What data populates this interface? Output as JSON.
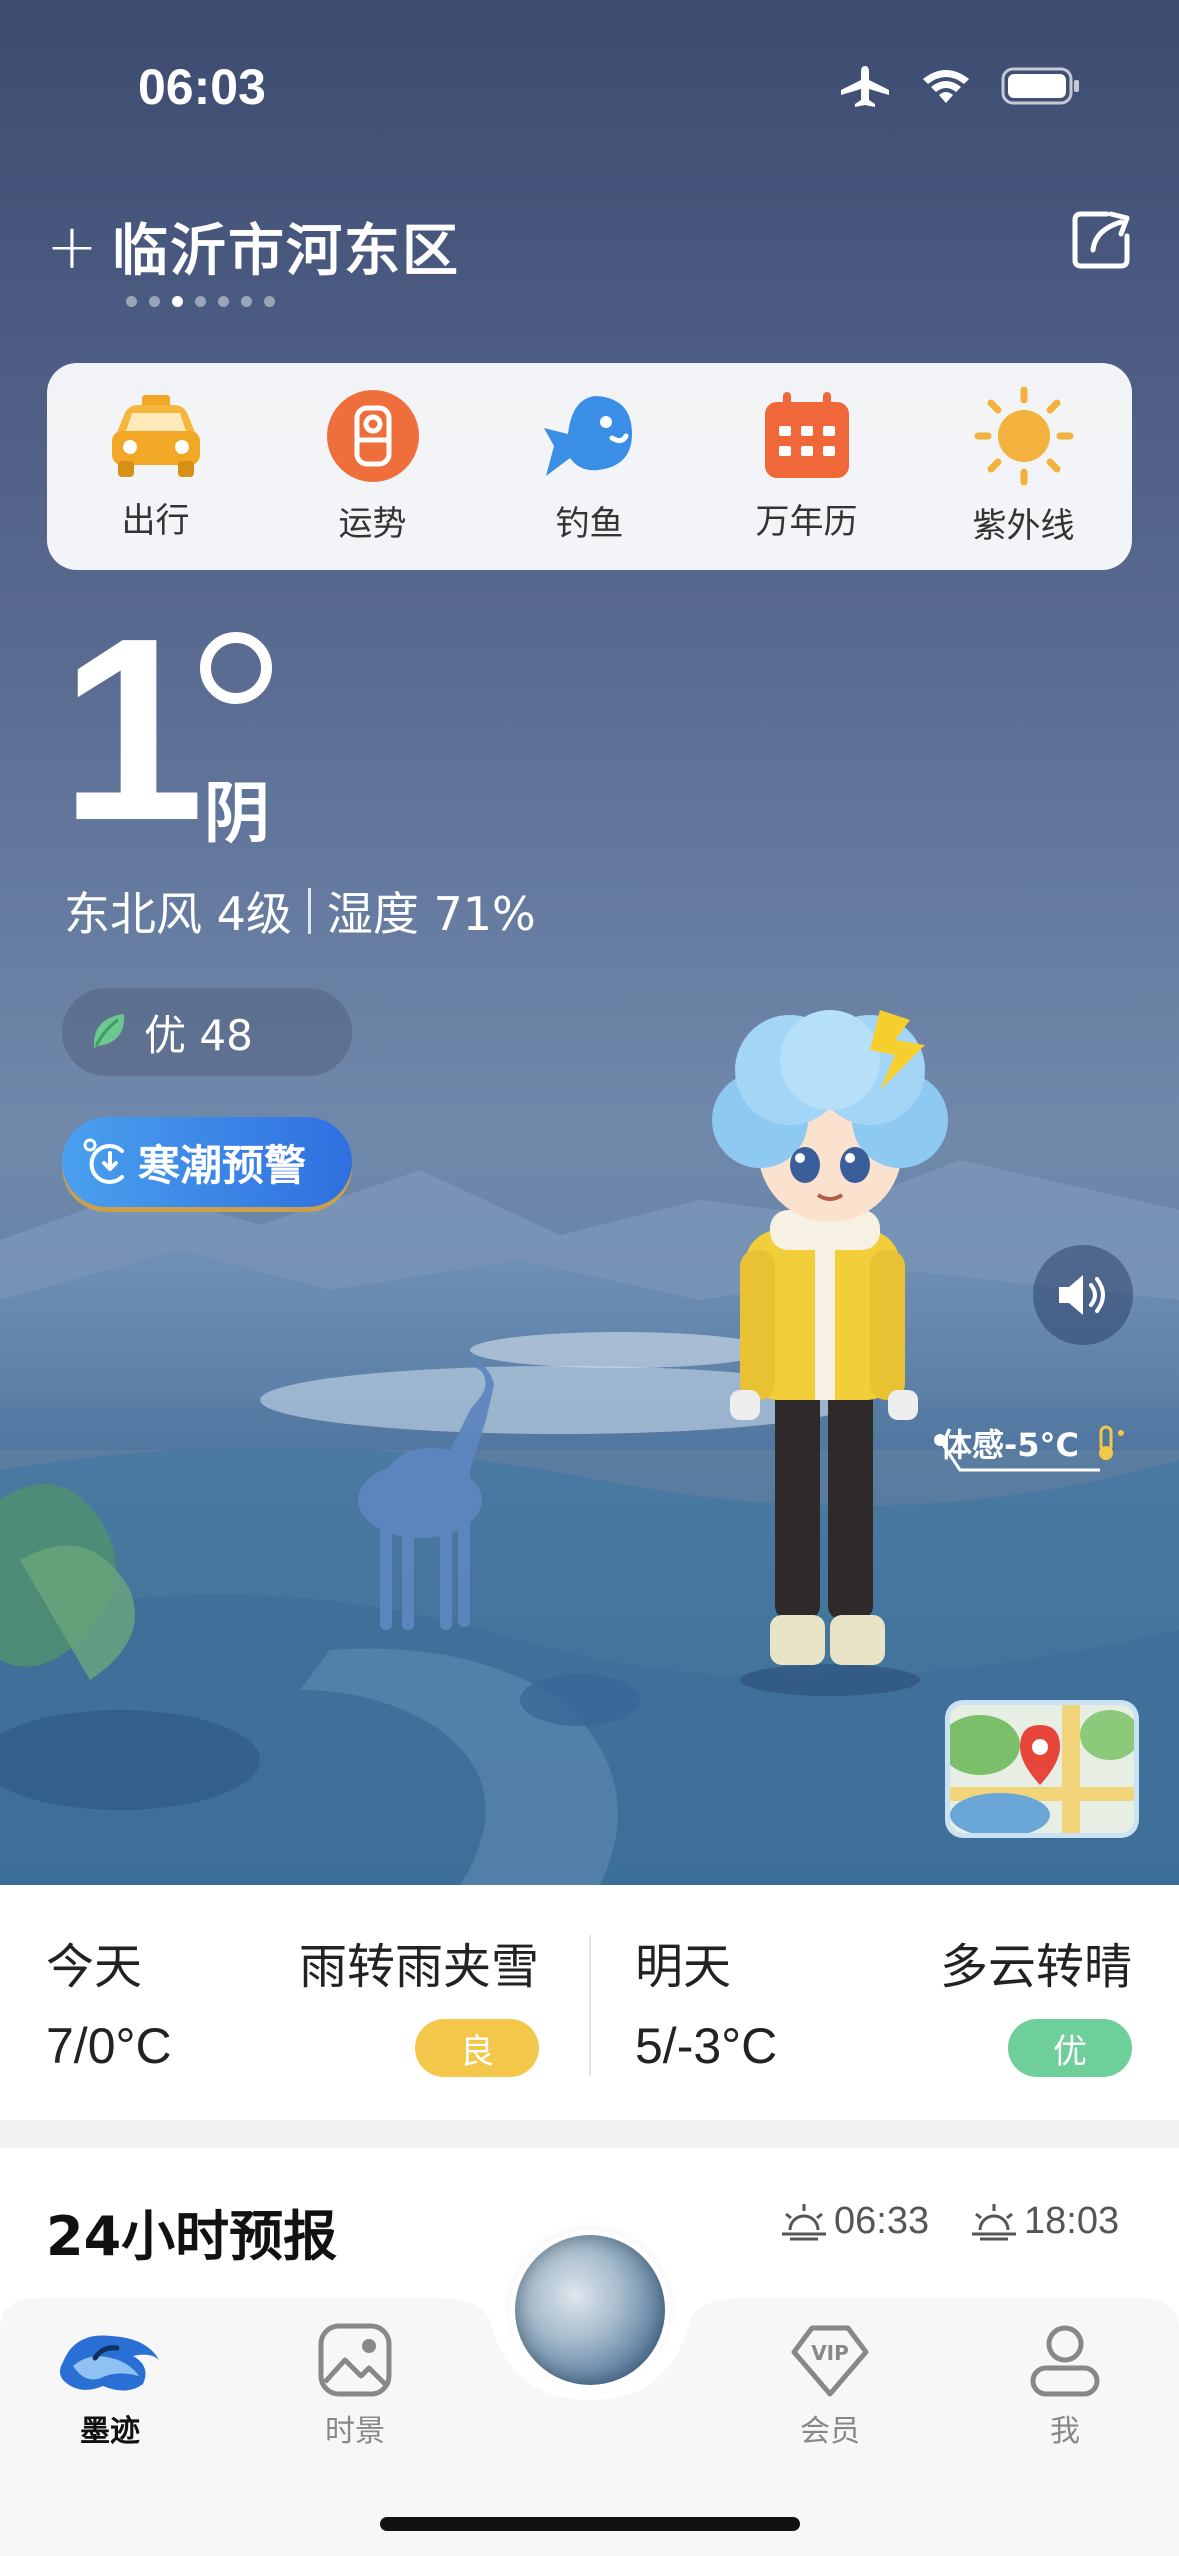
{
  "status_bar": {
    "time": "06:03",
    "icons": [
      "airplane-icon",
      "wifi-icon",
      "battery-icon"
    ]
  },
  "location": {
    "name": "临沂市河东区",
    "add_icon": "plus-icon",
    "share_icon": "share-icon",
    "page_count": 7,
    "active_page": 3
  },
  "quick_bar": [
    {
      "label": "出行",
      "icon": "taxi-icon"
    },
    {
      "label": "运势",
      "icon": "fortune-icon"
    },
    {
      "label": "钓鱼",
      "icon": "fish-icon"
    },
    {
      "label": "万年历",
      "icon": "calendar-icon"
    },
    {
      "label": "紫外线",
      "icon": "sun-icon"
    }
  ],
  "current": {
    "temperature": "1",
    "condition": "阴",
    "wind": "东北风 4级",
    "humidity": "湿度 71%",
    "aqi_label": "优 48",
    "warning": "寒潮预警",
    "feels_like": "体感-5°C"
  },
  "forecast": {
    "today": {
      "label": "今天",
      "condition": "雨转雨夹雪",
      "temp": "7/0°C",
      "aqi": "良",
      "aqi_color": "#f3c84a"
    },
    "tomorrow": {
      "label": "明天",
      "condition": "多云转晴",
      "temp": "5/-3°C",
      "aqi": "优",
      "aqi_color": "#6fcf9b"
    }
  },
  "hourly": {
    "title": "24小时预报",
    "sunrise": "06:33",
    "sunset": "18:03"
  },
  "nav": [
    {
      "label": "墨迹",
      "icon": "moji-logo-icon",
      "active": true
    },
    {
      "label": "时景",
      "icon": "image-icon",
      "active": false
    },
    {
      "label": "会员",
      "icon": "vip-icon",
      "active": false
    },
    {
      "label": "我",
      "icon": "user-icon",
      "active": false
    }
  ],
  "colors": {
    "sky_top": "#3e4d73",
    "sky_mid": "#5d7399",
    "accent_blue": "#3a86e8"
  }
}
